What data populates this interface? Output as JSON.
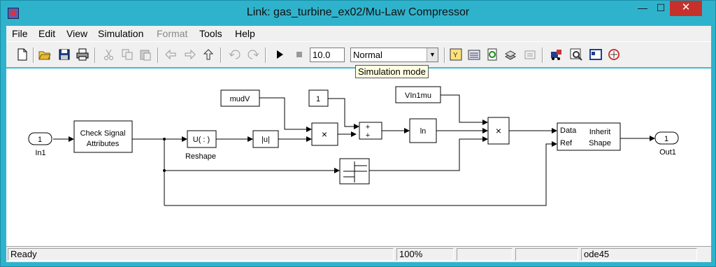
{
  "window": {
    "title": "Link: gas_turbine_ex02/Mu-Law Compressor"
  },
  "menu": {
    "file": "File",
    "edit": "Edit",
    "view": "View",
    "simulation": "Simulation",
    "format": "Format",
    "tools": "Tools",
    "help": "Help"
  },
  "toolbar": {
    "stop_time": "10.0",
    "sim_mode": "Normal",
    "tooltip": "Simulation mode"
  },
  "diagram": {
    "in1_num": "1",
    "in1_label": "In1",
    "check_l1": "Check Signal",
    "check_l2": "Attributes",
    "reshape_text": "U( : )",
    "reshape_label": "Reshape",
    "abs_text": "|u|",
    "mudv": "mudV",
    "const1": "1",
    "product_sign": "×",
    "sum_plus1": "+",
    "sum_plus2": "+",
    "vin1mu": "VIn1mu",
    "ln_text": "ln",
    "product2_sign": "×",
    "inherit_data": "Data",
    "inherit_ref": "Ref",
    "inherit_l1": "Inherit",
    "inherit_l2": "Shape",
    "out1_num": "1",
    "out1_label": "Out1"
  },
  "status": {
    "ready": "Ready",
    "zoom": "100%",
    "solver": "ode45"
  }
}
